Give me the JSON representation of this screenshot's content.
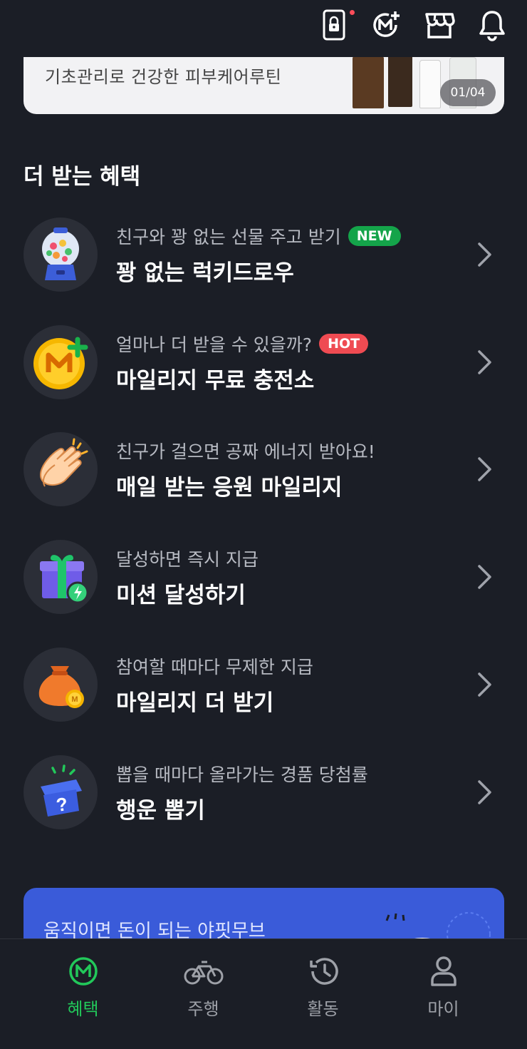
{
  "header": {
    "icons": [
      "lock-phone-icon",
      "mileage-plus-icon",
      "store-icon",
      "bell-icon"
    ],
    "notification_dot_color": "#ff4d5a"
  },
  "banner": {
    "text": "기초관리로 건강한 피부케어루틴",
    "pager": "01/04"
  },
  "benefits": {
    "title": "더 받는 혜택",
    "items": [
      {
        "subtitle": "친구와 꽝 없는 선물 주고 받기",
        "badge": "NEW",
        "title": "꽝 없는 럭키드로우",
        "icon": "gumball-machine-icon"
      },
      {
        "subtitle": "얼마나 더 받을 수 있을까?",
        "badge": "HOT",
        "title": "마일리지 무료 충전소",
        "icon": "m-coin-plus-icon"
      },
      {
        "subtitle": "친구가 걸으면 공짜 에너지 받아요!",
        "title": "매일 받는 응원 마일리지",
        "icon": "clapping-hands-icon"
      },
      {
        "subtitle": "달성하면 즉시 지급",
        "title": "미션 달성하기",
        "icon": "gift-box-icon"
      },
      {
        "subtitle": "참여할 때마다 무제한 지급",
        "title": "마일리지 더 받기",
        "icon": "money-bag-icon"
      },
      {
        "subtitle": "뽑을 때마다 올라가는 경품 당첨률",
        "title": "행운 뽑기",
        "icon": "mystery-box-icon"
      }
    ]
  },
  "promo": {
    "text": "움직이면 돈이 되는 야핏무브"
  },
  "bottom_nav": {
    "items": [
      {
        "label": "혜택",
        "icon": "m-circle-icon",
        "active": true
      },
      {
        "label": "주행",
        "icon": "bicycle-icon",
        "active": false
      },
      {
        "label": "활동",
        "icon": "history-icon",
        "active": false
      },
      {
        "label": "마이",
        "icon": "person-icon",
        "active": false
      }
    ]
  },
  "colors": {
    "background": "#1b1e26",
    "accent_green": "#22c85a",
    "badge_new": "#14a44a",
    "badge_hot": "#ef4b52",
    "promo_blue": "#3a5bd9"
  }
}
